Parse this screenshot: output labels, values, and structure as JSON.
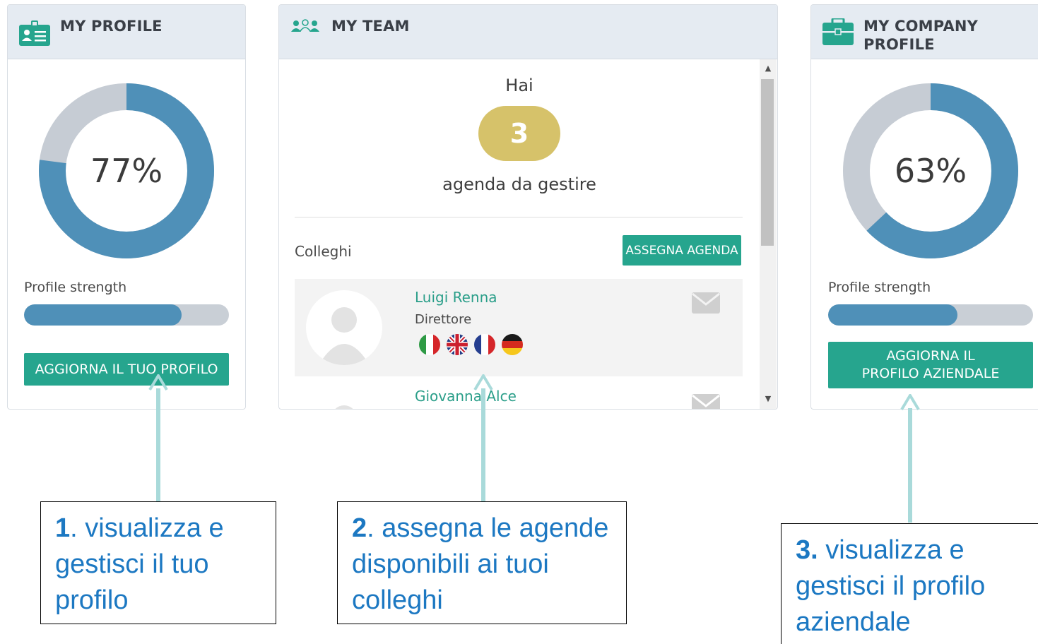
{
  "my_profile": {
    "title": "MY PROFILE",
    "percent_label": "77%",
    "percent": 77,
    "strength_label": "Profile strength",
    "strength_fraction": 0.77,
    "button_label": "AGGIORNA IL TUO PROFILO"
  },
  "my_team": {
    "title": "MY TEAM",
    "hai": "Hai",
    "agenda_count": "3",
    "agenda_text": "agenda da gestire",
    "colleghi_label": "Colleghi",
    "assign_button": "ASSEGNA AGENDA",
    "colleagues": [
      {
        "name": "Luigi Renna",
        "role": "Direttore",
        "flags": [
          "it",
          "gb",
          "fr",
          "de"
        ]
      },
      {
        "name": "Giovanna Alce",
        "role": "",
        "flags": []
      }
    ]
  },
  "my_company": {
    "title_line1": "MY COMPANY",
    "title_line2": "PROFILE",
    "percent_label": "63%",
    "percent": 63,
    "strength_label": "Profile strength",
    "strength_fraction": 0.63,
    "button_line1": "AGGIORNA IL",
    "button_line2": "PROFILO AZIENDALE"
  },
  "annotations": [
    {
      "number": "1",
      "sep": ". ",
      "text": "visualizza e gestisci il tuo profilo"
    },
    {
      "number": "2",
      "sep": ". ",
      "text": "assegna le agende disponibili ai tuoi colleghi"
    },
    {
      "number": "3.",
      "sep": " ",
      "text": "visualizza e gestisci il profilo aziendale"
    }
  ],
  "colors": {
    "accent_teal": "#26a58e",
    "donut_blue": "#4f90b8",
    "donut_gray": "#c6ccd4",
    "badge_gold": "#d6c26a",
    "annotation_blue": "#1c78c2",
    "arrow": "#a9dada"
  }
}
